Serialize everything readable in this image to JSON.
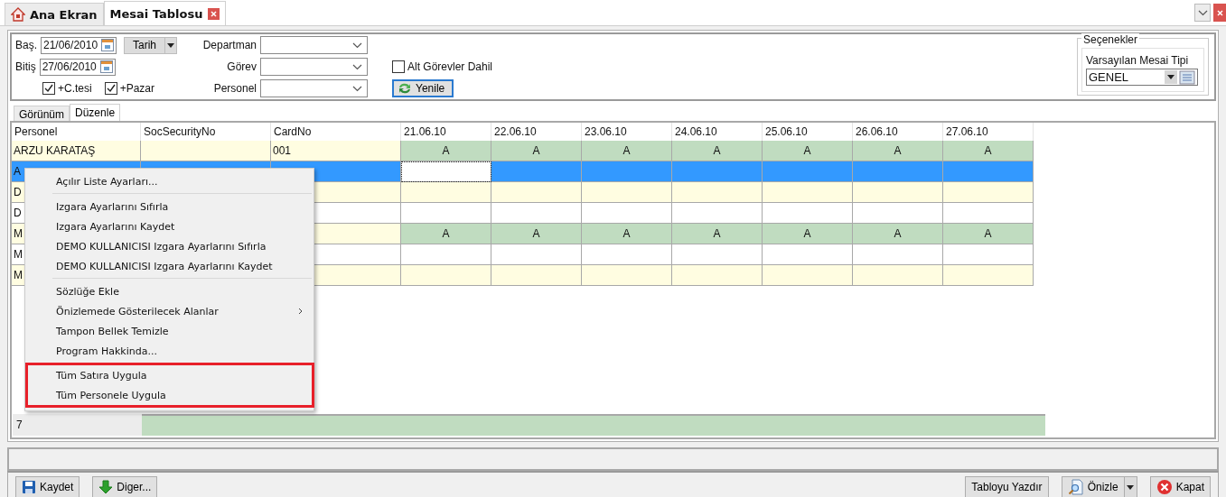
{
  "tabs": [
    {
      "label": "Ana Ekran",
      "selected": false,
      "kind": "home"
    },
    {
      "label": "Mesai Tablosu",
      "selected": true,
      "kind": "closable"
    }
  ],
  "filters": {
    "start_label": "Baş.",
    "start_date": "21/06/2010",
    "period_button": "Tarih",
    "end_label": "Bitiş",
    "end_date": "27/06/2010",
    "checkboxes": [
      {
        "label": "+C.tesi",
        "checked": true
      },
      {
        "label": "+Pazar",
        "checked": true
      }
    ],
    "combos": [
      {
        "label": "Departman"
      },
      {
        "label": "Görev"
      },
      {
        "label": "Personel"
      }
    ],
    "sub_roles": {
      "label": "Alt Görevler Dahil",
      "checked": false
    },
    "refresh_button": "Yenile"
  },
  "options": {
    "title": "Seçenekler",
    "label": "Varsayılan Mesai Tipi",
    "value": "GENEL"
  },
  "view_tabs": [
    {
      "label": "Görünüm",
      "selected": false
    },
    {
      "label": "Düzenle",
      "selected": true
    }
  ],
  "grid": {
    "columns": [
      "Personel",
      "SocSecurityNo",
      "CardNo",
      "21.06.10",
      "22.06.10",
      "23.06.10",
      "24.06.10",
      "25.06.10",
      "26.06.10",
      "27.06.10"
    ],
    "rows": [
      {
        "personel": "ARZU KARATAŞ",
        "card_no": "001",
        "days": [
          "A",
          "A",
          "A",
          "A",
          "A",
          "A",
          "A"
        ],
        "color": "#fffde1",
        "selected": false
      },
      {
        "personel": "A",
        "selected": true
      },
      {
        "personel": "D",
        "color": "#fffde1",
        "selected": false
      },
      {
        "personel": "D",
        "color": "#ffffff",
        "selected": false
      },
      {
        "personel": "M",
        "days": [
          "A",
          "A",
          "A",
          "A",
          "A",
          "A",
          "A"
        ],
        "color": "#fffde1",
        "selected": false
      },
      {
        "personel": "M",
        "color": "#ffffff",
        "selected": false
      },
      {
        "personel": "M",
        "color": "#fffde1",
        "selected": false
      }
    ],
    "footer_count": "7"
  },
  "menu": {
    "groups": [
      {
        "highlighted": false,
        "items": [
          {
            "label": "Açılır Liste Ayarları..."
          }
        ]
      },
      {
        "highlighted": false,
        "items": [
          {
            "label": "Izgara Ayarlarını Sıfırla"
          },
          {
            "label": "Izgara Ayarlarını Kaydet"
          },
          {
            "label": "DEMO KULLANICISI Izgara Ayarlarını Sıfırla"
          },
          {
            "label": "DEMO KULLANICISI Izgara Ayarlarını Kaydet"
          }
        ]
      },
      {
        "highlighted": false,
        "items": [
          {
            "label": "Sözlüğe Ekle"
          },
          {
            "label": "Önizlemede Gösterilecek Alanlar",
            "submenu": true
          },
          {
            "label": "Tampon Bellek Temizle"
          },
          {
            "label": "Program Hakkinda..."
          }
        ]
      },
      {
        "highlighted": true,
        "items": [
          {
            "label": "Tüm Satıra Uygula"
          },
          {
            "label": "Tüm Personele Uygula"
          }
        ]
      }
    ]
  },
  "buttons_left": [
    {
      "label": "Kaydet",
      "kind": "save"
    },
    {
      "label": "Diger...",
      "kind": "down"
    }
  ],
  "buttons_right": [
    {
      "label": "Tabloyu Yazdır",
      "kind": "plain"
    },
    {
      "label": "Önizle",
      "kind": "preview",
      "split": true
    },
    {
      "label": "Kapat",
      "kind": "close"
    }
  ]
}
